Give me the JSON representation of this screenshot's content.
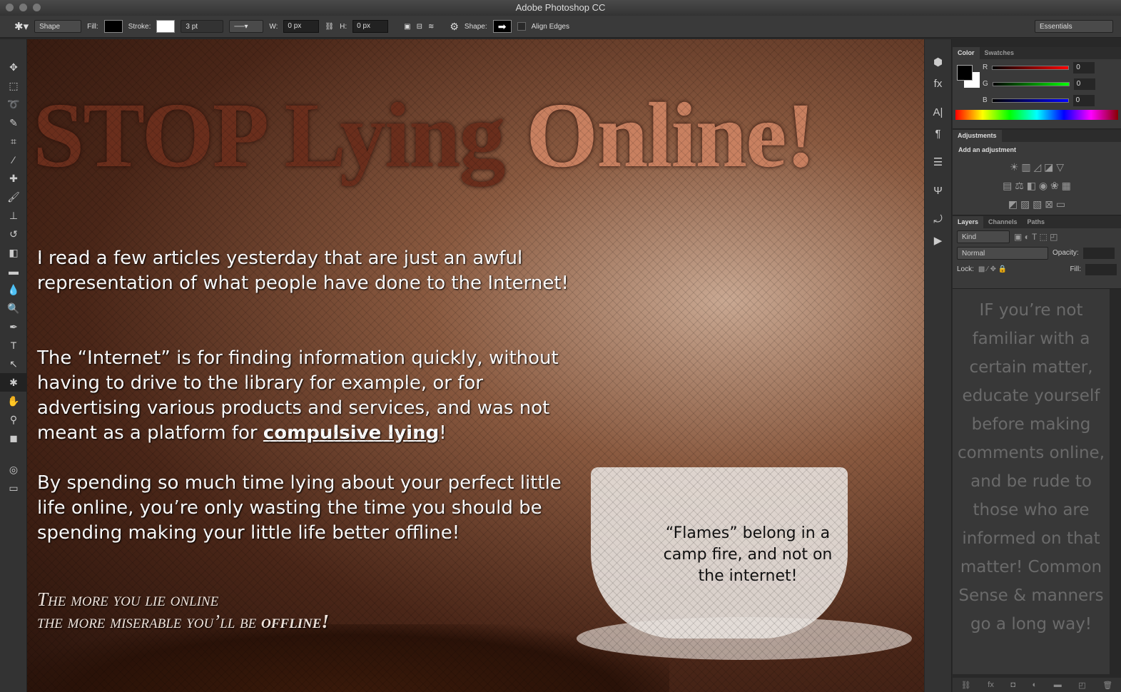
{
  "app": {
    "title": "Adobe Photoshop CC"
  },
  "options": {
    "mode": "Shape",
    "fill_label": "Fill:",
    "stroke_label": "Stroke:",
    "stroke_width": "3 pt",
    "w_label": "W:",
    "w_value": "0 px",
    "h_label": "H:",
    "h_value": "0 px",
    "shape_label": "Shape:",
    "align_edges": "Align Edges",
    "workspace": "Essentials"
  },
  "canvas": {
    "headline_a": "STOP Lying ",
    "headline_b": "Online!",
    "p1": "I read a few articles yesterday that are just an awful representation of what people have done to the Internet!",
    "p2a": "The “Internet” is for finding information quickly, without having to drive to the library for example, or for advertising various products and services, and was not meant as a platform for ",
    "p2b": "compulsive lying",
    "p2c": "!",
    "p3": "By spending so much time lying about your perfect little life online, you’re only wasting the time you should be spending making your little life better offline!",
    "motto1": "The more you lie online",
    "motto2a": "the more miserable you’ll be ",
    "motto2b": "offline!",
    "quote": "“Flames” belong in a camp fire, and not on the internet!"
  },
  "color_panel": {
    "tabs": [
      "Color",
      "Swatches"
    ],
    "r_label": "R",
    "g_label": "G",
    "b_label": "B",
    "r": "0",
    "g": "0",
    "b": "0"
  },
  "adjustments": {
    "tab": "Adjustments",
    "heading": "Add an adjustment"
  },
  "layers": {
    "tabs": [
      "Layers",
      "Channels",
      "Paths"
    ],
    "kind": "Kind",
    "blend": "Normal",
    "opacity_label": "Opacity:",
    "lock_label": "Lock:",
    "fill_label": "Fill:",
    "note": "IF you’re not familiar with a certain matter, educate yourself before making comments online, and be rude to those who are informed on that matter! Common Sense & manners go a long way!"
  }
}
